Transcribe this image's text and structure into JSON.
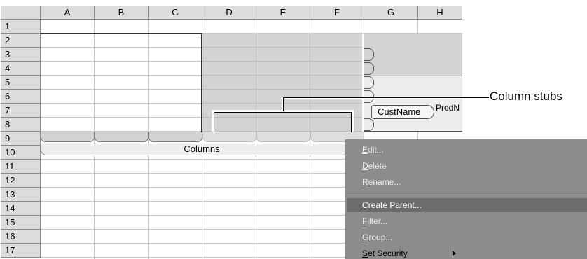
{
  "columns": [
    "A",
    "B",
    "C",
    "D",
    "E",
    "F",
    "G",
    "H"
  ],
  "rows": [
    "1",
    "2",
    "3",
    "4",
    "5",
    "6",
    "7",
    "8",
    "9",
    "10",
    "11",
    "12",
    "13",
    "14",
    "15",
    "16",
    "17"
  ],
  "columns_bar_label": "Columns",
  "cust_name_label": "CustName",
  "prod_label": "ProdN",
  "callout_label": "Column stubs",
  "context_menu": {
    "items": [
      {
        "pre": "",
        "acc": "E",
        "post": "dit...",
        "highlighted": false
      },
      {
        "pre": "",
        "acc": "D",
        "post": "elete",
        "highlighted": false
      },
      {
        "pre": "",
        "acc": "R",
        "post": "ename...",
        "highlighted": false
      },
      {
        "pre": "",
        "acc": "C",
        "post": "reate Parent...",
        "highlighted": true
      },
      {
        "pre": "",
        "acc": "F",
        "post": "ilter...",
        "highlighted": false
      },
      {
        "pre": "",
        "acc": "G",
        "post": "roup...",
        "highlighted": false
      },
      {
        "pre": "",
        "acc": "S",
        "post": "et Security",
        "highlighted": false,
        "submenu": true
      }
    ]
  },
  "colors": {
    "selection_fill": "#d3d3d3",
    "menu_background": "#8c8c8c",
    "menu_highlight": "#6c6c6c"
  }
}
